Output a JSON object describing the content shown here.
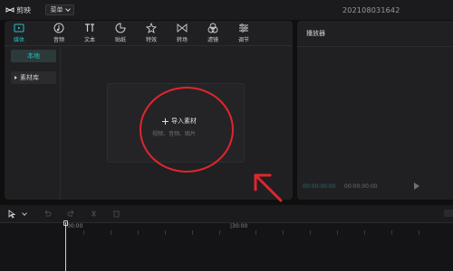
{
  "app": {
    "name": "剪映",
    "menu_label": "菜单",
    "project_title": "202108031642"
  },
  "toolbar": {
    "items": [
      {
        "label": "媒体",
        "icon": "media-icon",
        "active": true
      },
      {
        "label": "音频",
        "icon": "audio-icon",
        "active": false
      },
      {
        "label": "文本",
        "icon": "text-icon",
        "active": false
      },
      {
        "label": "贴纸",
        "icon": "sticker-icon",
        "active": false
      },
      {
        "label": "特效",
        "icon": "effect-icon",
        "active": false
      },
      {
        "label": "转场",
        "icon": "transition-icon",
        "active": false
      },
      {
        "label": "滤镜",
        "icon": "filter-icon",
        "active": false
      },
      {
        "label": "调节",
        "icon": "adjust-icon",
        "active": false
      }
    ]
  },
  "sidebar": {
    "local": "本地",
    "library": "素材库"
  },
  "import": {
    "title": "导入素材",
    "subtitle": "视频、音频、图片"
  },
  "player": {
    "title": "播放器",
    "time_current": "00:00:00:00",
    "time_total": "00:00:00:00"
  },
  "timeline": {
    "ruler": [
      "00:00",
      "|30:00"
    ]
  },
  "colors": {
    "accent": "#22c1c3",
    "annotation": "#e0262c",
    "panel": "#202023",
    "background": "#0f0f10"
  }
}
